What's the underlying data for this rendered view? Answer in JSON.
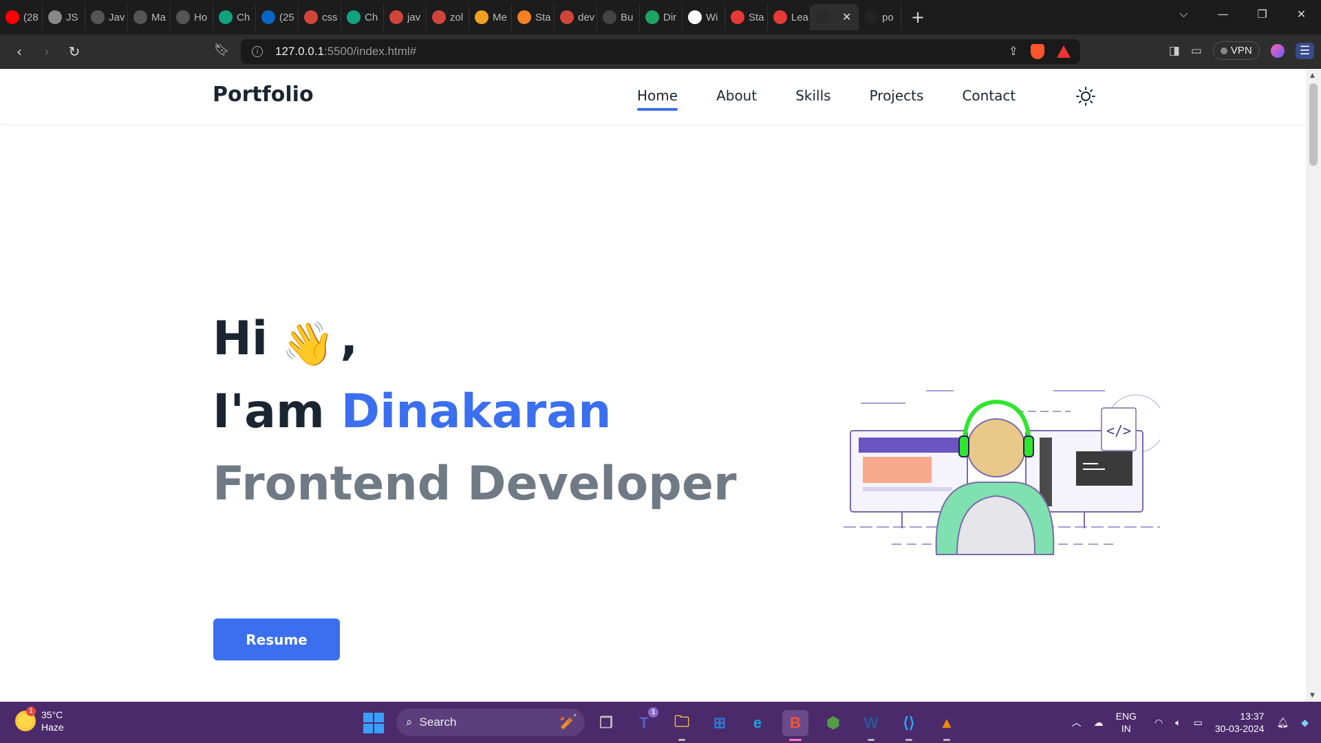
{
  "browser": {
    "tabs": [
      {
        "title": "(28",
        "icon": "youtube-icon",
        "color": "#ff0000"
      },
      {
        "title": "JS",
        "icon": "globe-icon",
        "color": "#888888"
      },
      {
        "title": "Jav",
        "icon": "medium-icon",
        "color": "#555555"
      },
      {
        "title": "Ma",
        "icon": "medium-icon",
        "color": "#555555"
      },
      {
        "title": "Ho",
        "icon": "hashnode-icon",
        "color": "#555555"
      },
      {
        "title": "Ch",
        "icon": "chatgpt-icon",
        "color": "#10a37f"
      },
      {
        "title": "(25",
        "icon": "linkedin-icon",
        "color": "#0a66c2"
      },
      {
        "title": "css",
        "icon": "brave-search-icon",
        "color": "#d0453a"
      },
      {
        "title": "Ch",
        "icon": "chatgpt-icon",
        "color": "#10a37f"
      },
      {
        "title": "jav",
        "icon": "brave-search-icon",
        "color": "#d0453a"
      },
      {
        "title": "zol",
        "icon": "brave-search-icon",
        "color": "#d0453a"
      },
      {
        "title": "Me",
        "icon": "medium-icon",
        "color": "#f0a020"
      },
      {
        "title": "Sta",
        "icon": "stackoverflow-icon",
        "color": "#f48024"
      },
      {
        "title": "dev",
        "icon": "brave-search-icon",
        "color": "#d0453a"
      },
      {
        "title": "Bu",
        "icon": "bookmark-doc-icon",
        "color": "#444444"
      },
      {
        "title": "Dir",
        "icon": "google-drive-icon",
        "color": "#1fa463"
      },
      {
        "title": "Wi",
        "icon": "wikipedia-icon",
        "color": "#ffffff"
      },
      {
        "title": "Sta",
        "icon": "record-icon",
        "color": "#e53935"
      },
      {
        "title": "Lea",
        "icon": "play-icon",
        "color": "#e53935"
      },
      {
        "title": "",
        "icon": "vite-icon",
        "color": "#2a2a2a",
        "active": true
      },
      {
        "title": "po",
        "icon": "github-icon",
        "color": "#222222"
      }
    ],
    "url_host": "127.0.0.1",
    "url_path": ":5500/index.html#",
    "vpn_label": "VPN"
  },
  "site": {
    "logo": "Portfolio",
    "nav": [
      "Home",
      "About",
      "Skills",
      "Projects",
      "Contact"
    ],
    "active_nav": "Home",
    "greeting": "Hi",
    "wave_emoji": "👋",
    "comma": ",",
    "iam": "I'am",
    "name": "Dinakaran",
    "role": "Frontend Developer",
    "resume_label": "Resume",
    "accent": "#3b6ff0",
    "code_symbol": "</>"
  },
  "taskbar": {
    "temperature": "35°C",
    "condition": "Haze",
    "weather_badge": "1",
    "search_placeholder": "Search",
    "apps": [
      {
        "name": "task-view",
        "label": "❐",
        "color": "#bfbfbf"
      },
      {
        "name": "teams",
        "label": "T",
        "color": "#5b5fc7"
      },
      {
        "name": "file-explorer",
        "label": "🗀",
        "color": "#f2c24a"
      },
      {
        "name": "ms-store",
        "label": "⊞",
        "color": "#2b7bd6"
      },
      {
        "name": "edge",
        "label": "e",
        "color": "#1fa2e0"
      },
      {
        "name": "brave",
        "label": "B",
        "color": "#fb542b",
        "active": true
      },
      {
        "name": "nodejs",
        "label": "⬢",
        "color": "#539e43"
      },
      {
        "name": "word",
        "label": "W",
        "color": "#2b5797"
      },
      {
        "name": "vscode",
        "label": "⟨⟩",
        "color": "#23a9f2"
      },
      {
        "name": "vlc",
        "label": "▲",
        "color": "#f08a00"
      }
    ],
    "teams_badge": "1",
    "lang1": "ENG",
    "lang2": "IN",
    "time": "13:37",
    "date": "30-03-2024"
  }
}
